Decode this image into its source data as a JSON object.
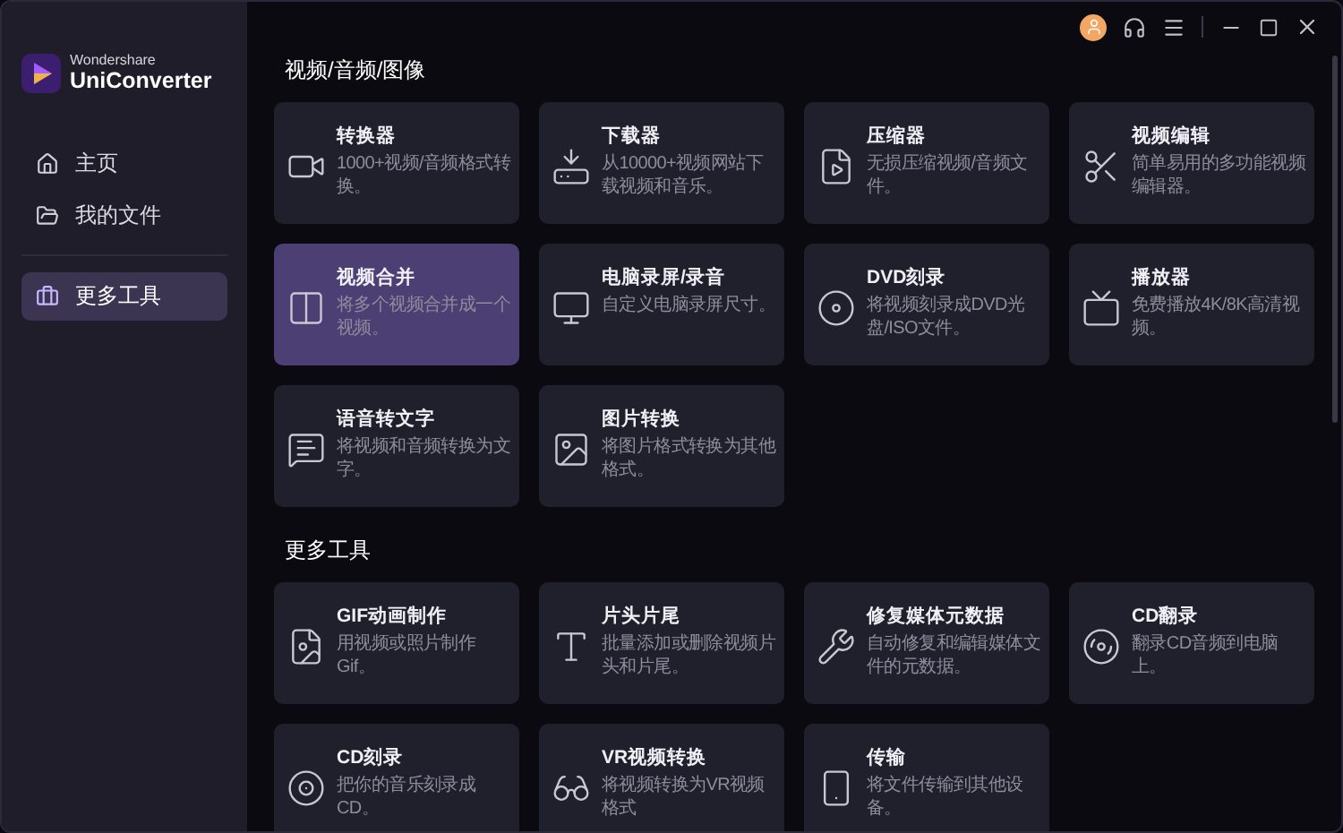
{
  "app": {
    "brand": "Wondershare",
    "product": "UniConverter"
  },
  "sidebar": {
    "groups": [
      {
        "items": [
          {
            "label": "主页",
            "selected": false
          },
          {
            "label": "我的文件",
            "selected": false
          }
        ]
      },
      {
        "items": [
          {
            "label": "更多工具",
            "selected": true
          }
        ]
      }
    ]
  },
  "sections": [
    {
      "title": "视频/音频/图像",
      "tools": [
        {
          "title": "转换器",
          "description": "1000+视频/音频格式转换。",
          "selected": false
        },
        {
          "title": "下载器",
          "description": "从10000+视频网站下载视频和音乐。",
          "selected": false
        },
        {
          "title": "压缩器",
          "description": "无损压缩视频/音频文件。",
          "selected": false
        },
        {
          "title": "视频编辑",
          "description": "简单易用的多功能视频编辑器。",
          "selected": false
        },
        {
          "title": "视频合并",
          "description": "将多个视频合并成一个视频。",
          "selected": true
        },
        {
          "title": "电脑录屏/录音",
          "description": "自定义电脑录屏尺寸。",
          "selected": false
        },
        {
          "title": "DVD刻录",
          "description": "将视频刻录成DVD光盘/ISO文件。",
          "selected": false
        },
        {
          "title": "播放器",
          "description": "免费播放4K/8K高清视频。",
          "selected": false
        },
        {
          "title": "语音转文字",
          "description": "将视频和音频转换为文字。",
          "selected": false
        },
        {
          "title": "图片转换",
          "description": "将图片格式转换为其他格式。",
          "selected": false
        }
      ]
    },
    {
      "title": "更多工具",
      "tools": [
        {
          "title": "GIF动画制作",
          "description": "用视频或照片制作Gif。",
          "selected": false
        },
        {
          "title": "片头片尾",
          "description": "批量添加或删除视频片头和片尾。",
          "selected": false
        },
        {
          "title": "修复媒体元数据",
          "description": "自动修复和编辑媒体文件的元数据。",
          "selected": false
        },
        {
          "title": "CD翻录",
          "description": "翻录CD音频到电脑上。",
          "selected": false
        },
        {
          "title": "CD刻录",
          "description": "把你的音乐刻录成CD。",
          "selected": false
        },
        {
          "title": "VR视频转换",
          "description": "将视频转换为VR视频格式",
          "selected": false
        },
        {
          "title": "传输",
          "description": "将文件传输到其他设备。",
          "selected": false
        }
      ]
    }
  ]
}
